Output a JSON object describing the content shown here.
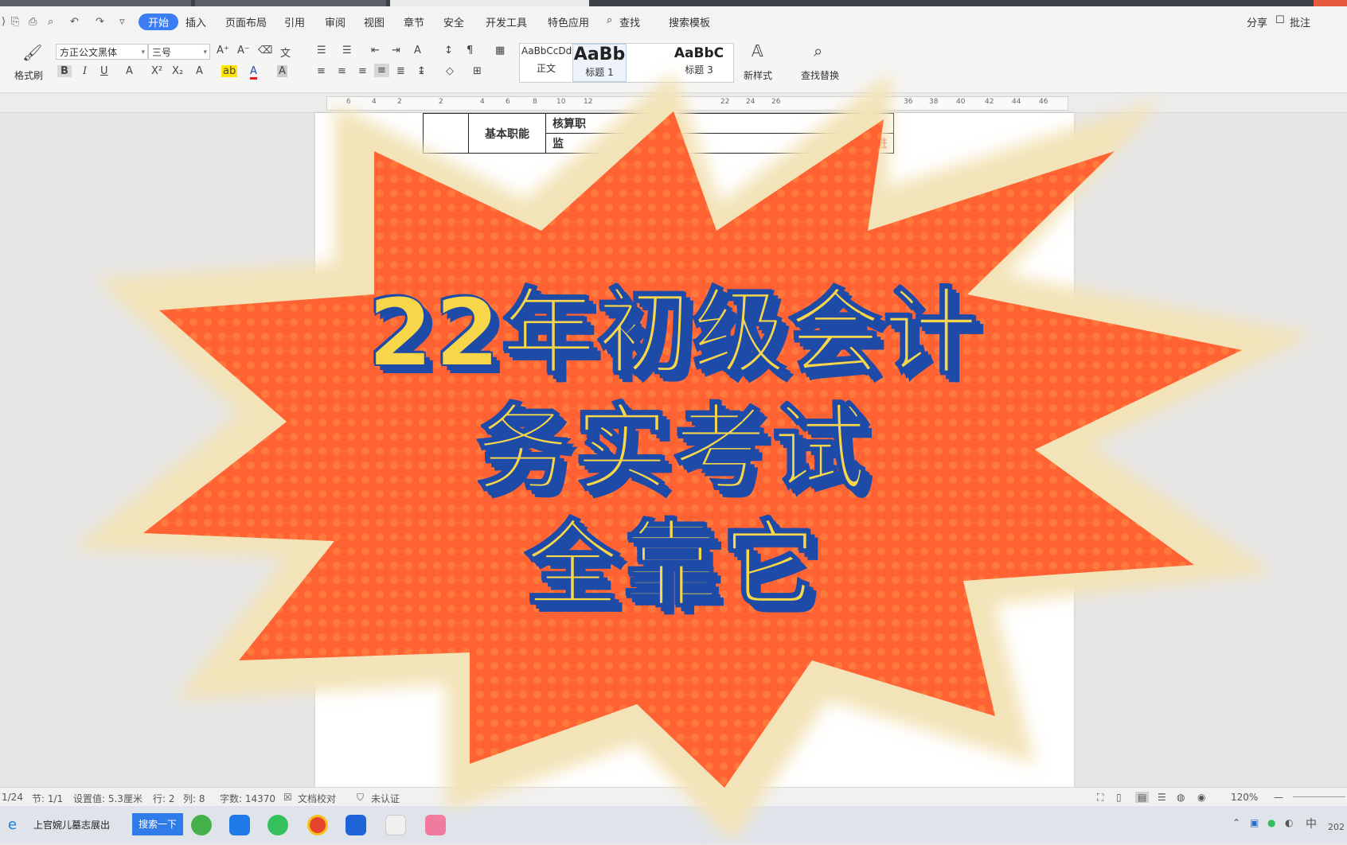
{
  "menubar": {
    "items": [
      "开始",
      "插入",
      "页面布局",
      "引用",
      "审阅",
      "视图",
      "章节",
      "安全",
      "开发工具",
      "特色应用",
      "查找",
      "搜索模板"
    ],
    "active_index": 0,
    "right": [
      "分享",
      "批注"
    ]
  },
  "ribbon": {
    "format_painter": "格式刷",
    "font_name": "方正公文黑体",
    "font_size": "三号",
    "styles": [
      {
        "preview": "AaBbCcDd",
        "label": "正文"
      },
      {
        "preview": "AaBb",
        "label": "标题 1"
      },
      {
        "preview": "AaBbC",
        "label": "标题 3"
      }
    ],
    "new_style": "新样式",
    "find_replace": "查找替换"
  },
  "ruler": {
    "ticks": [
      "6",
      "4",
      "2",
      "2",
      "4",
      "6",
      "8",
      "10",
      "12",
      "22",
      "24",
      "26",
      "36",
      "38",
      "40",
      "42",
      "44",
      "46"
    ]
  },
  "document": {
    "cell_label": "基本职能",
    "cell_top": "核算职",
    "cell_bottom": "监",
    "cell_right": "理性进"
  },
  "overlay": {
    "line1": "22年初级会计",
    "line2": "务实考试",
    "line3": "全靠它",
    "colors": {
      "burst": "#ff6333",
      "halo": "#f3e3b8",
      "text": "#f7d64a",
      "shadow": "#1e4aa8"
    }
  },
  "statusbar": {
    "page": "1/24",
    "section": "节: 1/1",
    "setting": "设置值: 5.3厘米",
    "row": "行: 2",
    "col": "列: 8",
    "words": "字数: 14370",
    "proof": "文档校对",
    "auth": "未认证",
    "zoom": "120%"
  },
  "taskbar": {
    "search_text": "上官婉儿墓志展出",
    "search_button": "搜索一下",
    "ime": "中",
    "clock": "202"
  }
}
